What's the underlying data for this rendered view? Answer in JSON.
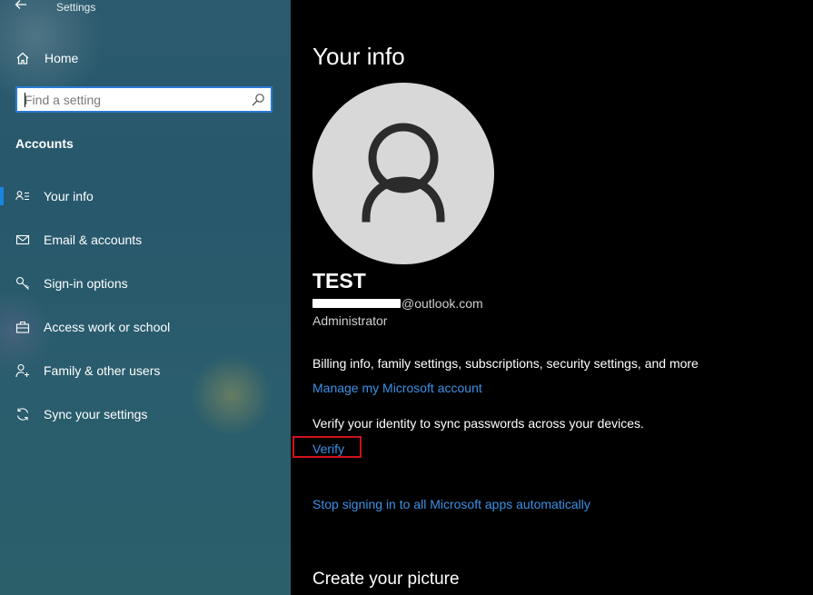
{
  "window": {
    "title": "Settings",
    "back_icon": "back-arrow-icon"
  },
  "sidebar": {
    "home_label": "Home",
    "search": {
      "placeholder": "Find a setting",
      "icon": "search-icon"
    },
    "section": "Accounts",
    "items": [
      {
        "label": "Your info",
        "icon": "person-card-icon",
        "selected": true
      },
      {
        "label": "Email & accounts",
        "icon": "mail-icon",
        "selected": false
      },
      {
        "label": "Sign-in options",
        "icon": "key-icon",
        "selected": false
      },
      {
        "label": "Access work or school",
        "icon": "briefcase-icon",
        "selected": false
      },
      {
        "label": "Family & other users",
        "icon": "person-add-icon",
        "selected": false
      },
      {
        "label": "Sync your settings",
        "icon": "sync-icon",
        "selected": false
      }
    ]
  },
  "main": {
    "title": "Your info",
    "user_name": "TEST",
    "email_suffix": "@outlook.com",
    "role": "Administrator",
    "billing_text": "Billing info, family settings, subscriptions, security settings, and more",
    "manage_link": "Manage my Microsoft account",
    "verify_text": "Verify your identity to sync passwords across your devices.",
    "verify_link": "Verify",
    "stop_link": "Stop signing in to all Microsoft apps automatically",
    "create_picture_title": "Create your picture"
  },
  "colors": {
    "accent": "#1a86e0",
    "link": "#3b91e6",
    "highlight_box": "#d0111b",
    "sidebar_bg": "#2a5a6d"
  }
}
